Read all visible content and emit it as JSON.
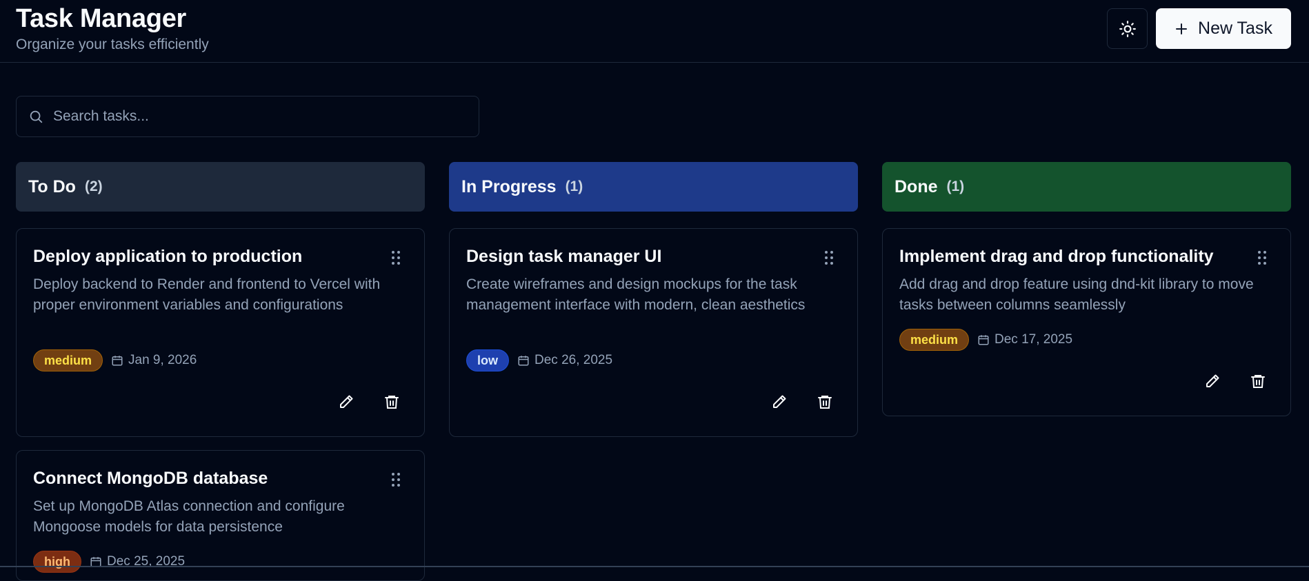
{
  "header": {
    "title": "Task Manager",
    "subtitle": "Organize your tasks efficiently",
    "theme_toggle_icon": "sun-icon",
    "new_task_label": "New Task"
  },
  "search": {
    "placeholder": "Search tasks...",
    "value": ""
  },
  "colors": {
    "background": "#020817",
    "todo": "#1e293b",
    "in_progress": "#1e3a8a",
    "done": "#14532d"
  },
  "columns": [
    {
      "title": "To Do",
      "count": "(2)",
      "cards": [
        {
          "title": "Deploy application to production",
          "description": "Deploy backend to Render and frontend to Vercel with proper environment variables and configurations",
          "priority": "medium",
          "date": "Jan 9, 2026"
        },
        {
          "title": "Connect MongoDB database",
          "description": "Set up MongoDB Atlas connection and configure Mongoose models for data persistence",
          "priority": "high",
          "date": "Dec 25, 2025"
        }
      ]
    },
    {
      "title": "In Progress",
      "count": "(1)",
      "cards": [
        {
          "title": "Design task manager UI",
          "description": "Create wireframes and design mockups for the task management interface with modern, clean aesthetics",
          "priority": "low",
          "date": "Dec 26, 2025"
        }
      ]
    },
    {
      "title": "Done",
      "count": "(1)",
      "cards": [
        {
          "title": "Implement drag and drop functionality",
          "description": "Add drag and drop feature using dnd-kit library to move tasks between columns seamlessly",
          "priority": "medium",
          "date": "Dec 17, 2025"
        }
      ]
    }
  ]
}
